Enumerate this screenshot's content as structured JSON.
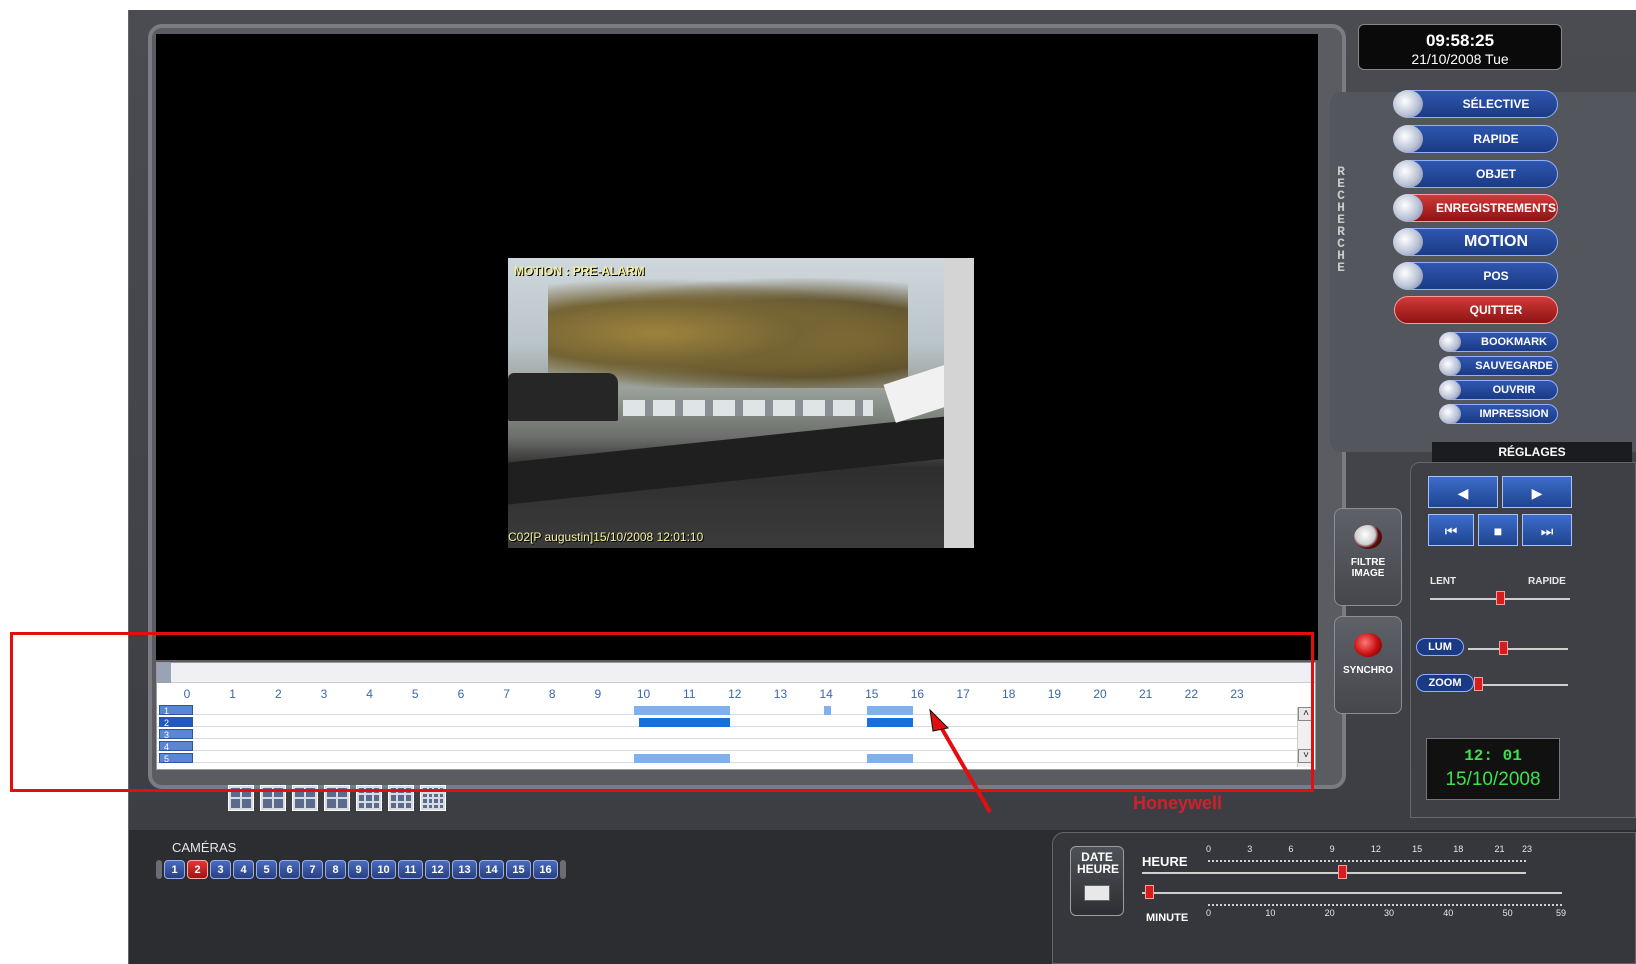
{
  "video": {
    "overlay_top": "MOTION : PRE-ALARM",
    "overlay_bottom": "C02[P augustin]15/10/2008 12:01:10"
  },
  "clock": {
    "time": "09:58:25",
    "date": "21/10/2008 Tue"
  },
  "recherche_label": "RECHERCHE",
  "search_buttons": [
    {
      "label": "SÉLECTIVE"
    },
    {
      "label": "RAPIDE"
    },
    {
      "label": "OBJET"
    },
    {
      "label": "ENREGISTREMENTS"
    },
    {
      "label": "MOTION"
    },
    {
      "label": "POS"
    },
    {
      "label": "QUITTER"
    }
  ],
  "small_buttons": [
    {
      "label": "BOOKMARK"
    },
    {
      "label": "SAUVEGARDE"
    },
    {
      "label": "OUVRIR"
    },
    {
      "label": "IMPRESSION"
    }
  ],
  "reglages": {
    "title": "RÉGLAGES",
    "speed_min": "LENT",
    "speed_max": "RAPIDE",
    "lum": "LUM",
    "zoom": "ZOOM",
    "speed_level": 0.5,
    "lum_level": 0.35,
    "zoom_level": 0.0
  },
  "side_buttons": {
    "filtre": "FILTRE IMAGE",
    "synchro": "SYNCHRO"
  },
  "info": {
    "time": "12: 01",
    "date": "15/10/2008"
  },
  "timeline": {
    "hours": [
      "0",
      "1",
      "2",
      "3",
      "4",
      "5",
      "6",
      "7",
      "8",
      "9",
      "10",
      "11",
      "12",
      "13",
      "14",
      "15",
      "16",
      "17",
      "18",
      "19",
      "20",
      "21",
      "22",
      "23"
    ],
    "rows": [
      "1",
      "2",
      "3",
      "4",
      "5"
    ],
    "selected_row": "2"
  },
  "brand": "Honeywell",
  "cameras": {
    "title": "CAMÉRAS",
    "buttons": [
      "1",
      "2",
      "3",
      "4",
      "5",
      "6",
      "7",
      "8",
      "9",
      "10",
      "11",
      "12",
      "13",
      "14",
      "15",
      "16"
    ],
    "active": "2"
  },
  "date_heure": {
    "button": "DATE HEURE",
    "heure_label": "HEURE",
    "minute_label": "MINUTE",
    "heure_ticks": [
      "0",
      "3",
      "6",
      "9",
      "12",
      "15",
      "18",
      "21",
      "23"
    ],
    "minute_ticks": [
      "0",
      "10",
      "20",
      "30",
      "40",
      "50",
      "59"
    ],
    "heure_value": 12,
    "minute_value": 1
  },
  "colors": {
    "annotation": "#e30f0f",
    "record_light": "#7fb1ee",
    "record_dark": "#1670e0",
    "clock_green": "#3fe04a"
  }
}
